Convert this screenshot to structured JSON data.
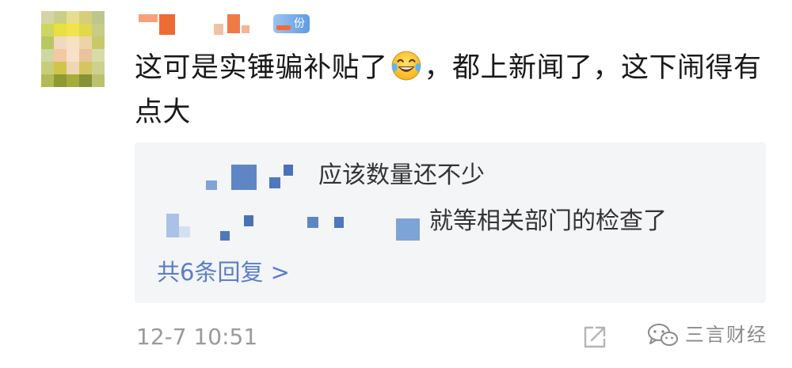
{
  "comment": {
    "author_level_badge": "份",
    "text_before_emoji": "这可是实锤骗补贴了",
    "emoji_name": "laughing-tears-emoji",
    "text_after_emoji": "，都上新闻了，这下闹得有点大"
  },
  "replies": [
    {
      "text": "应该数量还不少"
    },
    {
      "text": "就等相关部门的检查了"
    }
  ],
  "more_replies_label": "共6条回复 >",
  "timestamp": "12-7 10:51",
  "watermark": {
    "text": "三言财经",
    "icon": "wechat-icon"
  },
  "icons": {
    "share": "share-icon"
  },
  "colors": {
    "link": "#5b7ec9",
    "reply_panel_bg": "#f4f5f7",
    "badge": "#5e9be6"
  }
}
